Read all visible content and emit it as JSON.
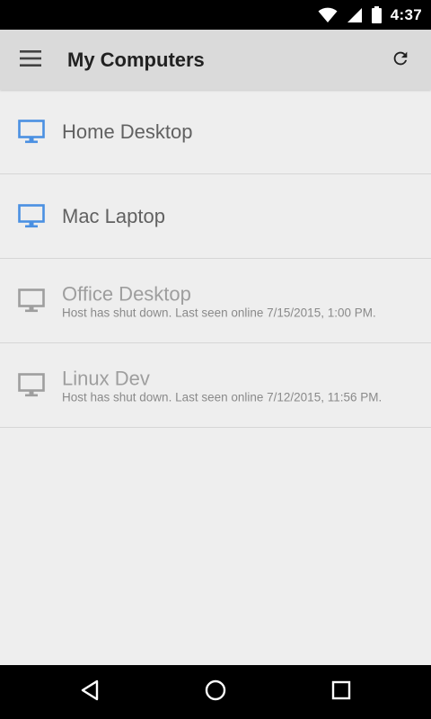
{
  "status_bar": {
    "time": "4:37",
    "icons": [
      "wifi-icon",
      "cellular-signal-icon",
      "battery-icon"
    ]
  },
  "app_bar": {
    "title": "My Computers",
    "menu_icon": "hamburger-menu-icon",
    "refresh_icon": "refresh-icon"
  },
  "hosts": [
    {
      "name": "Home Desktop",
      "status": "",
      "online": true,
      "icon": "monitor-icon"
    },
    {
      "name": "Mac Laptop",
      "status": "",
      "online": true,
      "icon": "monitor-icon"
    },
    {
      "name": "Office Desktop",
      "status": "Host has shut down. Last seen online 7/15/2015, 1:00 PM.",
      "online": false,
      "icon": "monitor-icon"
    },
    {
      "name": "Linux Dev",
      "status": "Host has shut down. Last seen online 7/12/2015, 11:56 PM.",
      "online": false,
      "icon": "monitor-icon"
    }
  ],
  "nav_bar": {
    "icons": [
      "back-icon",
      "home-icon",
      "recents-icon"
    ]
  },
  "colors": {
    "online_icon": "#4a90e2",
    "offline_icon": "#9e9e9e",
    "app_bar_bg": "#dadada",
    "list_bg": "#eeeeee"
  }
}
